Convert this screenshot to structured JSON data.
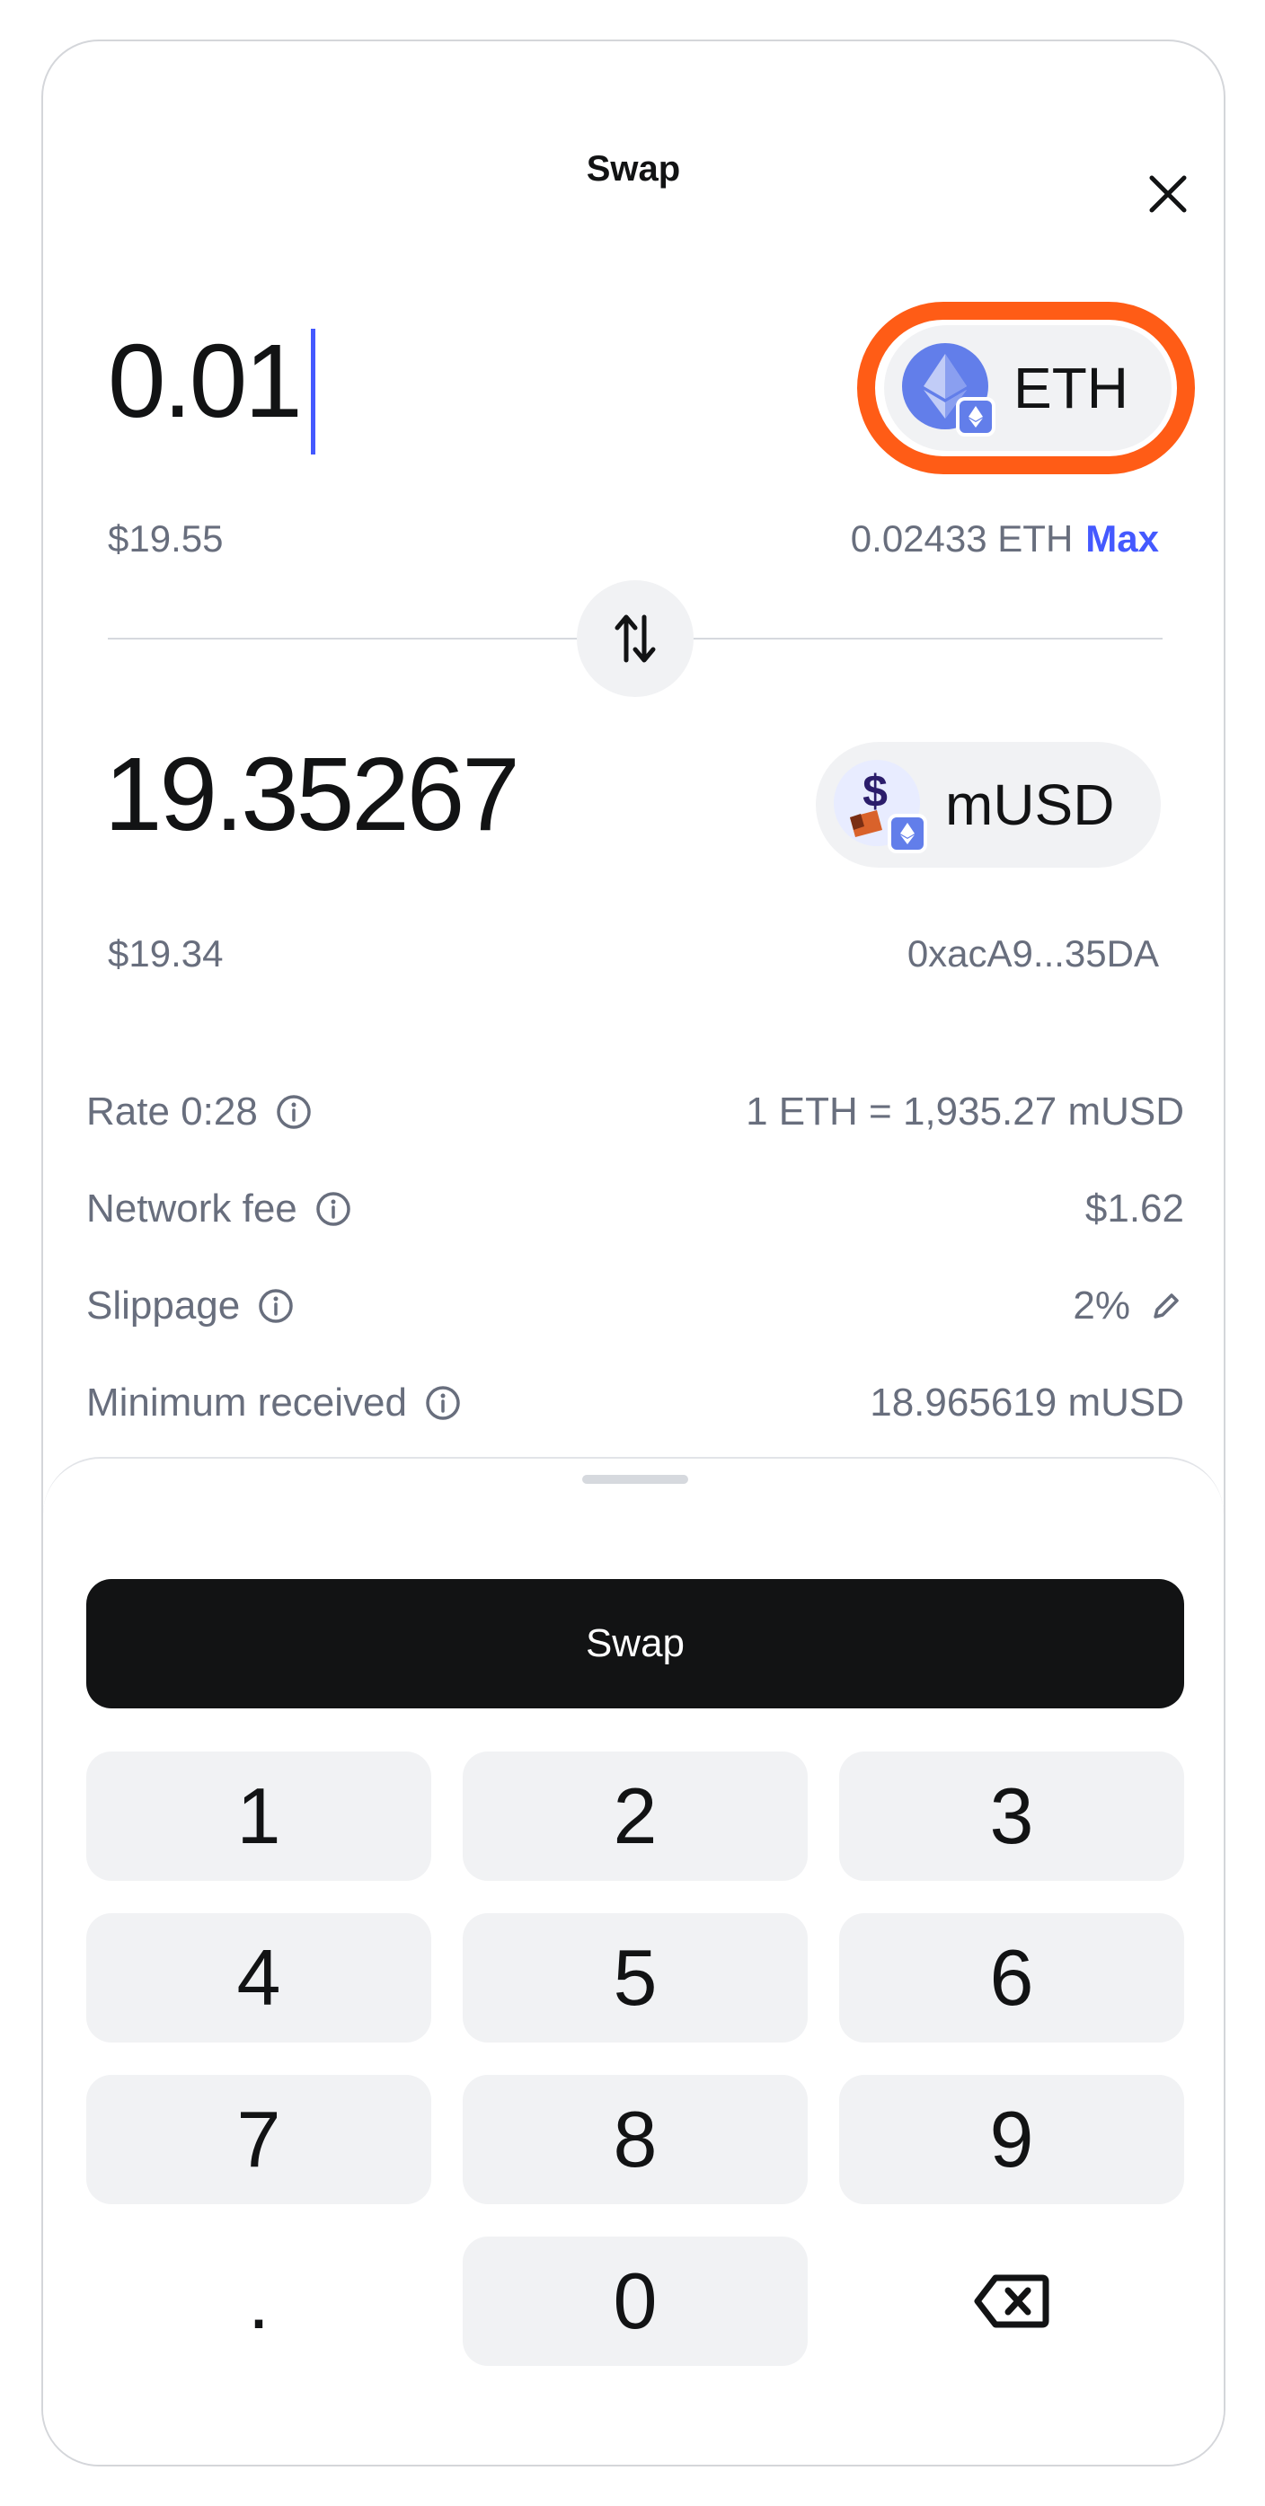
{
  "header": {
    "title": "Swap"
  },
  "from": {
    "amount": "0.01",
    "fiat": "$19.55",
    "token_symbol": "ETH",
    "balance": "0.02433 ETH",
    "max_label": "Max"
  },
  "to": {
    "amount": "19.35267",
    "fiat": "$19.34",
    "token_symbol": "mUSD",
    "address": "0xacA9...35DA"
  },
  "details": {
    "rate_label": "Rate 0:28",
    "rate_value": "1 ETH = 1,935.27 mUSD",
    "fee_label": "Network fee",
    "fee_value": "$1.62",
    "slippage_label": "Slippage",
    "slippage_value": "2%",
    "min_label": "Minimum received",
    "min_value": "18.965619 mUSD"
  },
  "actions": {
    "swap_label": "Swap"
  },
  "keypad": {
    "keys": [
      "1",
      "2",
      "3",
      "4",
      "5",
      "6",
      "7",
      "8",
      "9",
      ".",
      "0"
    ]
  },
  "colors": {
    "accent": "#4459ff",
    "highlight": "#ff5c16",
    "eth": "#627eea",
    "primary_button": "#121314"
  },
  "icons": [
    "close-icon",
    "eth-icon",
    "network-badge-icon",
    "swap-arrows-icon",
    "musd-icon",
    "info-icon",
    "pencil-icon",
    "backspace-icon"
  ]
}
